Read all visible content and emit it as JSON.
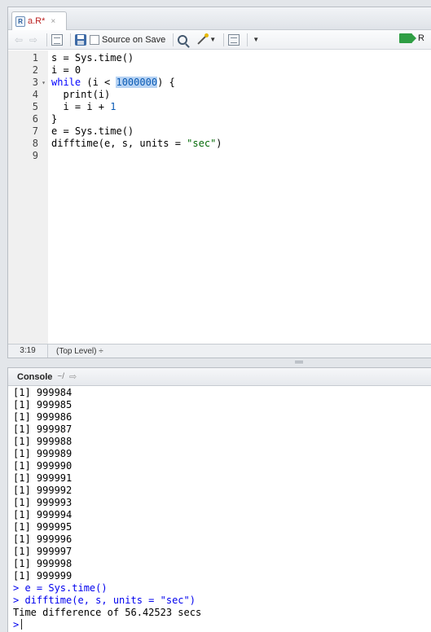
{
  "editor": {
    "tab": {
      "filename": "a.R*",
      "close": "×"
    },
    "toolbar": {
      "source_on_save_label": "Source on Save",
      "run_label": "R"
    },
    "gutter": [
      "1",
      "2",
      "3",
      "4",
      "5",
      "6",
      "7",
      "8",
      "9"
    ],
    "code": {
      "l1": "s = Sys.time()",
      "l2": "i = 0",
      "l3_kw": "while",
      "l3_a": " (i < ",
      "l3_num": "1000000",
      "l3_b": ") {",
      "l4": "  print(i)",
      "l5_a": "  i = i + ",
      "l5_num": "1",
      "l6": "}",
      "l7": "e = Sys.time()",
      "l8_a": "difftime(e, s, units = ",
      "l8_str": "\"sec\"",
      "l8_b": ")",
      "l9": ""
    },
    "status": {
      "position": "3:19",
      "scope": "(Top Level) ÷"
    }
  },
  "console": {
    "title": "Console",
    "path": "~/",
    "output": [
      "[1] 999984",
      "[1] 999985",
      "[1] 999986",
      "[1] 999987",
      "[1] 999988",
      "[1] 999989",
      "[1] 999990",
      "[1] 999991",
      "[1] 999992",
      "[1] 999993",
      "[1] 999994",
      "[1] 999995",
      "[1] 999996",
      "[1] 999997",
      "[1] 999998",
      "[1] 999999"
    ],
    "cmd1": "> e = Sys.time()",
    "cmd2": "> difftime(e, s, units = \"sec\")",
    "result": "Time difference of 56.42523 secs",
    "prompt": ">"
  }
}
